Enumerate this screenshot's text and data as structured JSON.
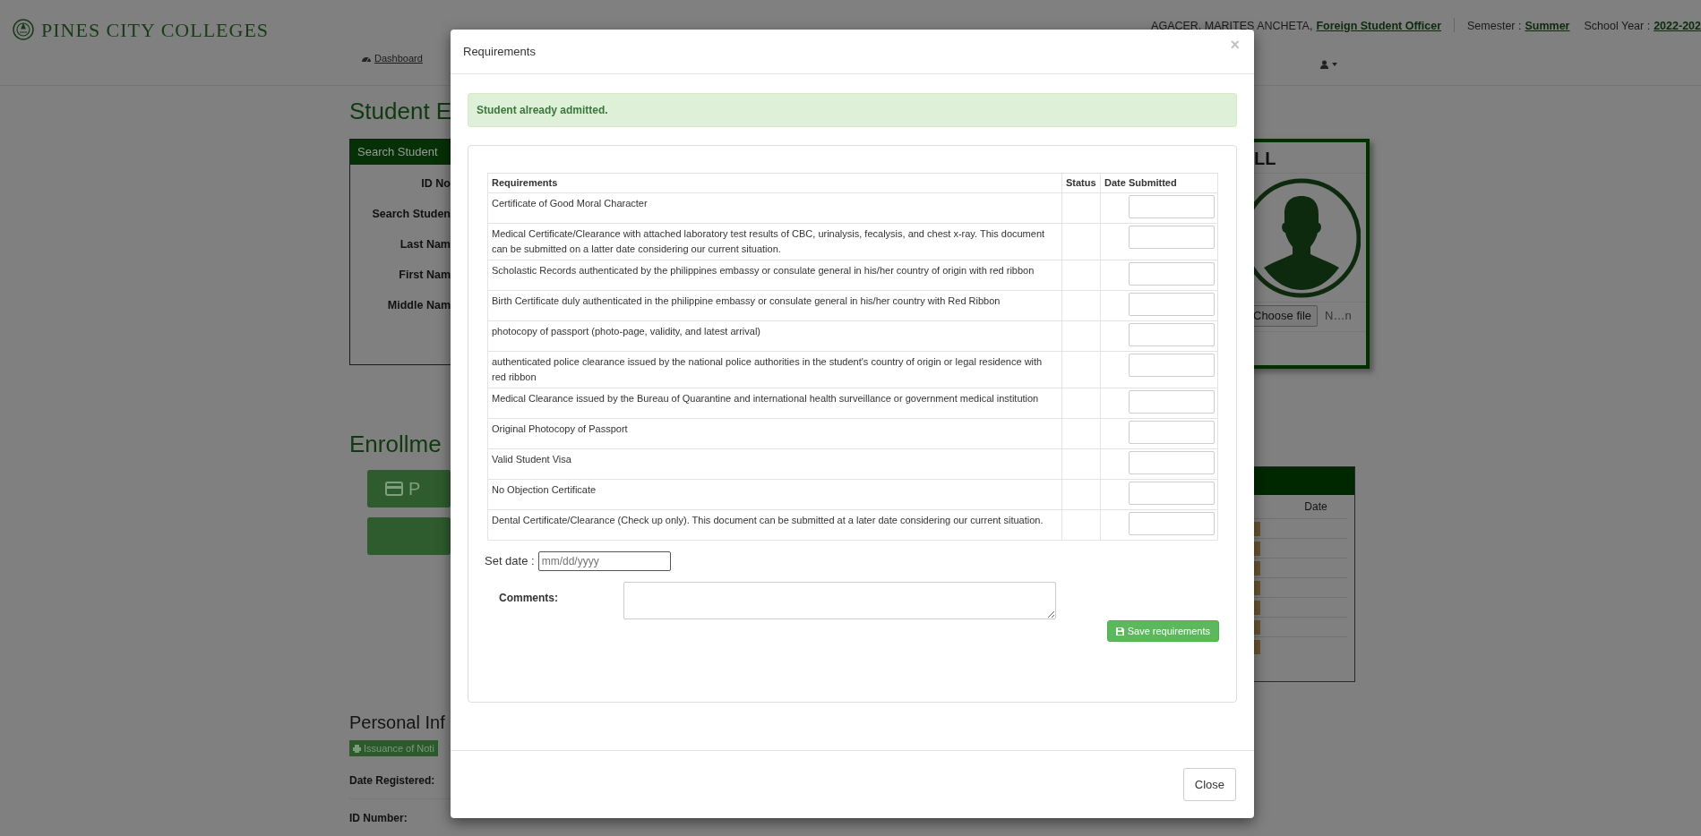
{
  "header": {
    "logo_text": "PINES CITY COLLEGES",
    "user_name": "AGACER, MARITES ANCHETA,",
    "role": "Foreign Student Officer",
    "semester_label": "Semester :",
    "semester": "Summer",
    "school_year_label": "School Year :",
    "school_year": "2022-202"
  },
  "nav": {
    "items": [
      {
        "label": "Dashboard"
      }
    ]
  },
  "student_section": {
    "title": "Student E",
    "search_panel": {
      "title": "Search Student",
      "labels": [
        "ID No",
        "Search Studen",
        "Last Nam",
        "First Nam",
        "Middle Nam"
      ]
    }
  },
  "enrollment_section": {
    "title": "Enrollme",
    "buttons": [
      {
        "kind": "card",
        "label": "P"
      },
      {
        "kind": "blank"
      }
    ]
  },
  "personal_info": {
    "title": "Personal Inf",
    "button": "Issuance of Noti",
    "fields": [
      "Date Registered:",
      "ID Number:"
    ]
  },
  "photo_card": {
    "title": "LL",
    "file_button": "Choose file",
    "file_name": "N…n"
  },
  "schedule_panel": {
    "columns": [
      "Date"
    ],
    "rows": [
      {
        "flag": true
      },
      {
        "flag": true
      },
      {
        "flag": true
      },
      {
        "flag": true
      },
      {
        "flag": true
      },
      {
        "flag": true
      },
      {
        "flag": true
      }
    ]
  },
  "modal": {
    "title": "Requirements",
    "close_icon": "×",
    "alert": "Student already admitted.",
    "table": {
      "columns": [
        "Requirements",
        "Status",
        "Date Submitted"
      ],
      "rows": [
        {
          "requirement": "Certificate of Good Moral Character"
        },
        {
          "requirement": "Medical Certificate/Clearance with attached laboratory test results of CBC, urinalysis, fecalysis, and chest x-ray. This document can be submitted on a latter date considering our current situation."
        },
        {
          "requirement": "Scholastic Records authenticated by the philippines embassy or consulate general in his/her country of origin with red ribbon"
        },
        {
          "requirement": "Birth Certificate duly authenticated in the philippine embassy or consulate general in his/her country with Red Ribbon"
        },
        {
          "requirement": "photocopy of passport (photo-page, validity, and latest arrival)"
        },
        {
          "requirement": "authenticated police clearance issued by the national police authorities in the student's country of origin or legal residence with red ribbon"
        },
        {
          "requirement": "Medical Clearance issued by the Bureau of Quarantine and international health surveillance or government medical institution"
        },
        {
          "requirement": "Original Photocopy of Passport"
        },
        {
          "requirement": "Valid Student Visa"
        },
        {
          "requirement": "No Objection Certificate"
        },
        {
          "requirement": "Dental Certificate/Clearance (Check up only). This document can be submitted at a later date considering our current situation."
        }
      ]
    },
    "set_date": {
      "label": "Set date :",
      "placeholder": "mm/dd/yyyy"
    },
    "comments_label": "Comments:",
    "save_button": "Save requirements",
    "close_button": "Close"
  }
}
